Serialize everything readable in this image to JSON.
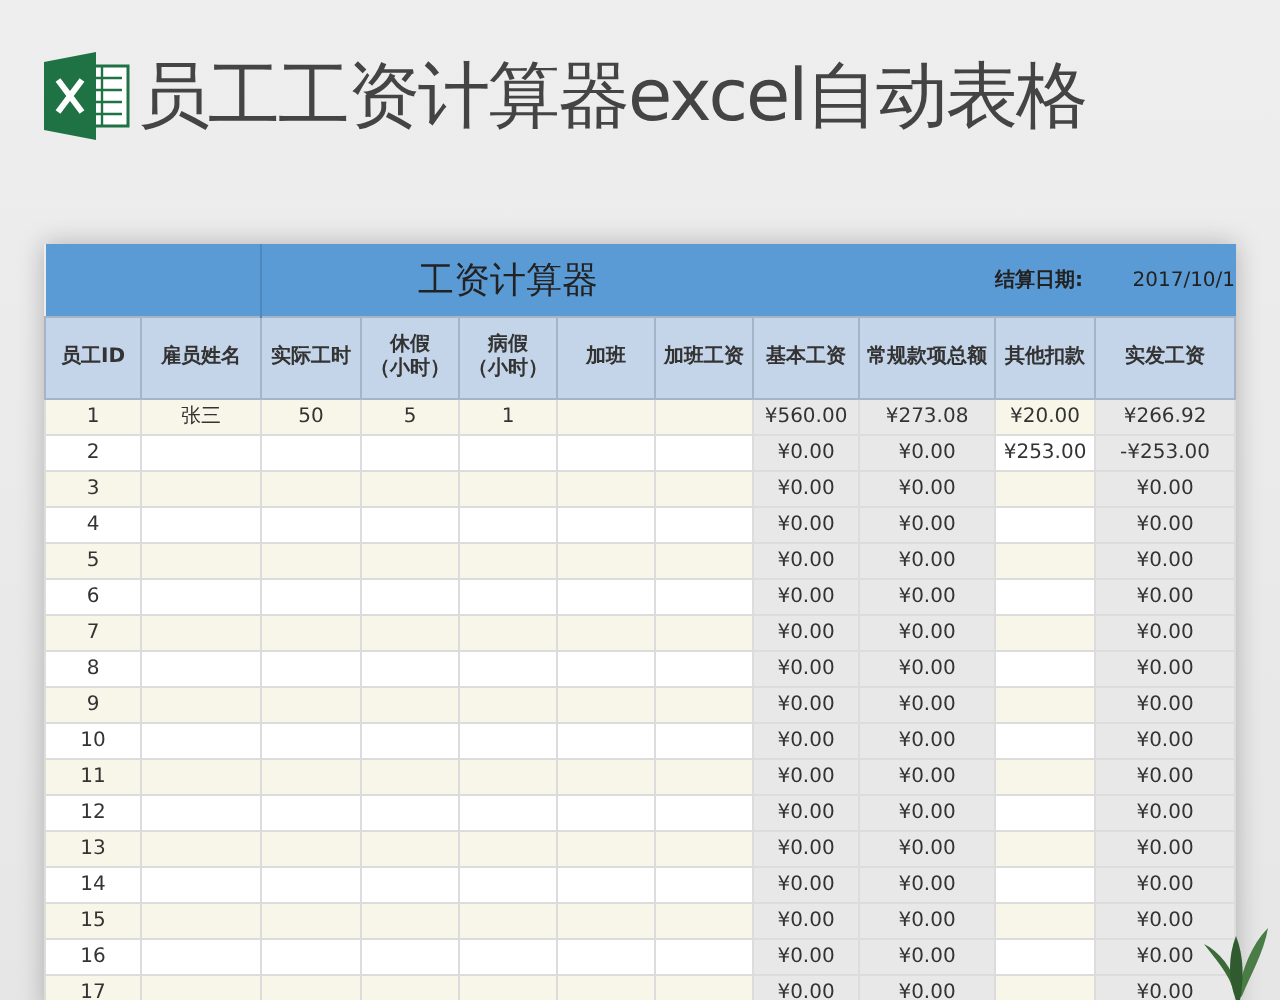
{
  "banner": {
    "title": "员工工资计算器excel自动表格"
  },
  "sheet": {
    "title": "工资计算器",
    "date_label": "结算日期:",
    "date_value": "2017/10/1",
    "columns": [
      {
        "label_lines": [
          "员工ID"
        ],
        "kind": "input"
      },
      {
        "label_lines": [
          "雇员姓名"
        ],
        "kind": "input"
      },
      {
        "label_lines": [
          "实际工时"
        ],
        "kind": "input"
      },
      {
        "label_lines": [
          "休假",
          "（小时）"
        ],
        "kind": "input"
      },
      {
        "label_lines": [
          "病假",
          "（小时）"
        ],
        "kind": "input"
      },
      {
        "label_lines": [
          "加班"
        ],
        "kind": "input"
      },
      {
        "label_lines": [
          "加班工资"
        ],
        "kind": "input"
      },
      {
        "label_lines": [
          "基本工资"
        ],
        "kind": "computed"
      },
      {
        "label_lines": [
          "常规款项总额"
        ],
        "kind": "computed"
      },
      {
        "label_lines": [
          "其他扣款"
        ],
        "kind": "input"
      },
      {
        "label_lines": [
          "实发工资"
        ],
        "kind": "computed"
      }
    ],
    "rows": [
      {
        "cells": [
          {
            "text": "1"
          },
          {
            "text": "张三"
          },
          {
            "text": "50"
          },
          {
            "text": "5"
          },
          {
            "text": "1"
          },
          {},
          {},
          {
            "text": "¥560.00"
          },
          {
            "text": "¥273.08"
          },
          {
            "text": "¥20.00"
          },
          {
            "text": "¥266.92"
          }
        ]
      },
      {
        "cells": [
          {
            "text": "2"
          },
          {},
          {},
          {},
          {},
          {},
          {},
          {
            "text": "¥0.00"
          },
          {
            "text": "¥0.00"
          },
          {
            "text": "¥253.00"
          },
          {
            "text": "-¥253.00"
          }
        ]
      },
      {
        "cells": [
          {
            "text": "3"
          },
          {},
          {},
          {},
          {},
          {},
          {},
          {
            "text": "¥0.00"
          },
          {
            "text": "¥0.00"
          },
          {},
          {
            "text": "¥0.00"
          }
        ]
      },
      {
        "cells": [
          {
            "text": "4"
          },
          {},
          {},
          {},
          {},
          {},
          {},
          {
            "text": "¥0.00"
          },
          {
            "text": "¥0.00"
          },
          {},
          {
            "text": "¥0.00"
          }
        ]
      },
      {
        "cells": [
          {
            "text": "5"
          },
          {},
          {},
          {},
          {},
          {},
          {},
          {
            "text": "¥0.00"
          },
          {
            "text": "¥0.00"
          },
          {},
          {
            "text": "¥0.00"
          }
        ]
      },
      {
        "cells": [
          {
            "text": "6"
          },
          {},
          {},
          {},
          {},
          {},
          {},
          {
            "text": "¥0.00"
          },
          {
            "text": "¥0.00"
          },
          {},
          {
            "text": "¥0.00"
          }
        ]
      },
      {
        "cells": [
          {
            "text": "7"
          },
          {},
          {},
          {},
          {},
          {},
          {},
          {
            "text": "¥0.00"
          },
          {
            "text": "¥0.00"
          },
          {},
          {
            "text": "¥0.00"
          }
        ]
      },
      {
        "cells": [
          {
            "text": "8"
          },
          {},
          {},
          {},
          {},
          {},
          {},
          {
            "text": "¥0.00"
          },
          {
            "text": "¥0.00"
          },
          {},
          {
            "text": "¥0.00"
          }
        ]
      },
      {
        "cells": [
          {
            "text": "9"
          },
          {},
          {},
          {},
          {},
          {},
          {},
          {
            "text": "¥0.00"
          },
          {
            "text": "¥0.00"
          },
          {},
          {
            "text": "¥0.00"
          }
        ]
      },
      {
        "cells": [
          {
            "text": "10"
          },
          {},
          {},
          {},
          {},
          {},
          {},
          {
            "text": "¥0.00"
          },
          {
            "text": "¥0.00"
          },
          {},
          {
            "text": "¥0.00"
          }
        ]
      },
      {
        "cells": [
          {
            "text": "11"
          },
          {},
          {},
          {},
          {},
          {},
          {},
          {
            "text": "¥0.00"
          },
          {
            "text": "¥0.00"
          },
          {},
          {
            "text": "¥0.00"
          }
        ]
      },
      {
        "cells": [
          {
            "text": "12"
          },
          {},
          {},
          {},
          {},
          {},
          {},
          {
            "text": "¥0.00"
          },
          {
            "text": "¥0.00"
          },
          {},
          {
            "text": "¥0.00"
          }
        ]
      },
      {
        "cells": [
          {
            "text": "13"
          },
          {},
          {},
          {},
          {},
          {},
          {},
          {
            "text": "¥0.00"
          },
          {
            "text": "¥0.00"
          },
          {},
          {
            "text": "¥0.00"
          }
        ]
      },
      {
        "cells": [
          {
            "text": "14"
          },
          {},
          {},
          {},
          {},
          {},
          {},
          {
            "text": "¥0.00"
          },
          {
            "text": "¥0.00"
          },
          {},
          {
            "text": "¥0.00"
          }
        ]
      },
      {
        "cells": [
          {
            "text": "15"
          },
          {},
          {},
          {},
          {},
          {},
          {},
          {
            "text": "¥0.00"
          },
          {
            "text": "¥0.00"
          },
          {},
          {
            "text": "¥0.00"
          }
        ]
      },
      {
        "cells": [
          {
            "text": "16"
          },
          {},
          {},
          {},
          {},
          {},
          {},
          {
            "text": "¥0.00"
          },
          {
            "text": "¥0.00"
          },
          {},
          {
            "text": "¥0.00"
          }
        ]
      },
      {
        "cells": [
          {
            "text": "17"
          },
          {},
          {},
          {},
          {},
          {},
          {},
          {
            "text": "¥0.00"
          },
          {
            "text": "¥0.00"
          },
          {},
          {
            "text": "¥0.00"
          }
        ]
      }
    ]
  }
}
